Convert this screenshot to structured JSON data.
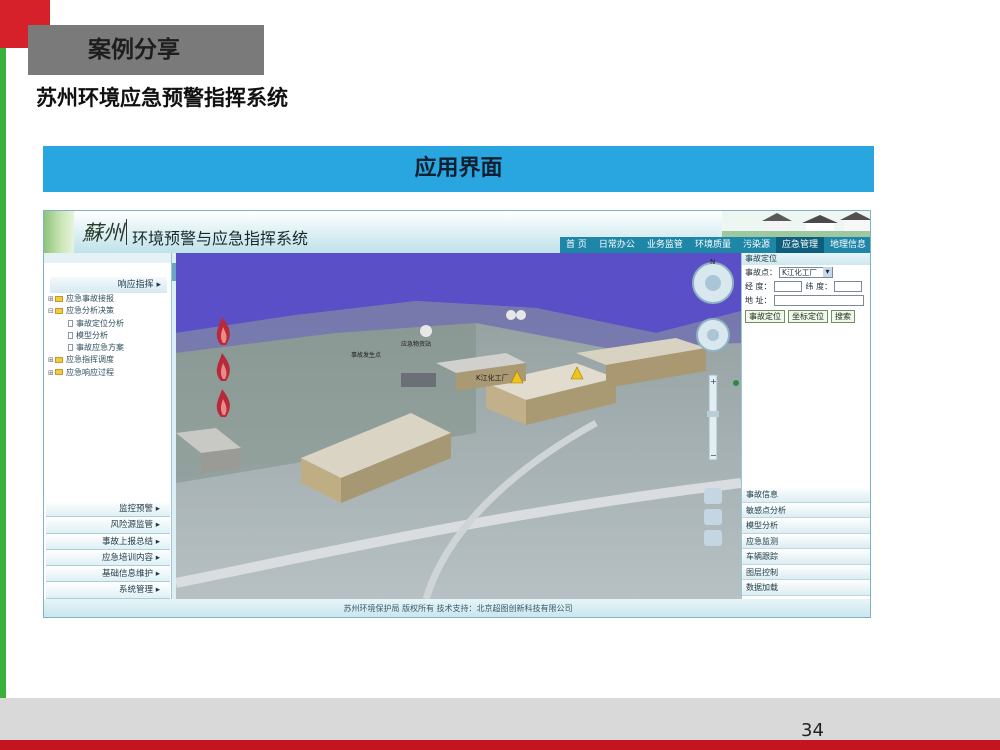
{
  "slide": {
    "section_tab": "案例分享",
    "title": "苏州环境应急预警指挥系统",
    "banner": "应用界面",
    "page_number": "34"
  },
  "app": {
    "logo_text": "蘇州",
    "title": "环境预警与应急指挥系统",
    "nav": [
      "首 页",
      "日常办公",
      "业务监管",
      "环境质量",
      "污染源",
      "应急管理",
      "地理信息"
    ],
    "active_nav": "应急管理",
    "left_panel": {
      "header": "响应指挥",
      "tree": [
        {
          "label": "应急事故接报",
          "level": 0
        },
        {
          "label": "应急分析决策",
          "level": 0
        },
        {
          "label": "事故定位分析",
          "level": 1
        },
        {
          "label": "模型分析",
          "level": 1
        },
        {
          "label": "事故应急方案",
          "level": 1
        },
        {
          "label": "应急指挥调度",
          "level": 0
        },
        {
          "label": "应急响应过程",
          "level": 0
        }
      ],
      "menu": [
        "监控预警",
        "风险源监管",
        "事故上报总结",
        "应急培训内容",
        "基础信息维护",
        "系统管理"
      ]
    },
    "map": {
      "labels": [
        "K江化工厂",
        "事故发生点",
        "应急物资站"
      ]
    },
    "right_panel": {
      "title": "事故定位",
      "accident_point_label": "事故点：",
      "accident_point_value": "K江化工厂",
      "longitude_label": "经  度：",
      "latitude_label": "纬  度：",
      "address_label": "地  址：",
      "buttons": [
        "事故定位",
        "坐标定位",
        "搜索"
      ],
      "accordion": [
        "事故信息",
        "敏感点分析",
        "模型分析",
        "应急监测",
        "车辆跟踪",
        "图层控制",
        "数据加载"
      ]
    },
    "footer": "苏州环境保护局 版权所有    技术支持：北京超图创新科技有限公司"
  }
}
